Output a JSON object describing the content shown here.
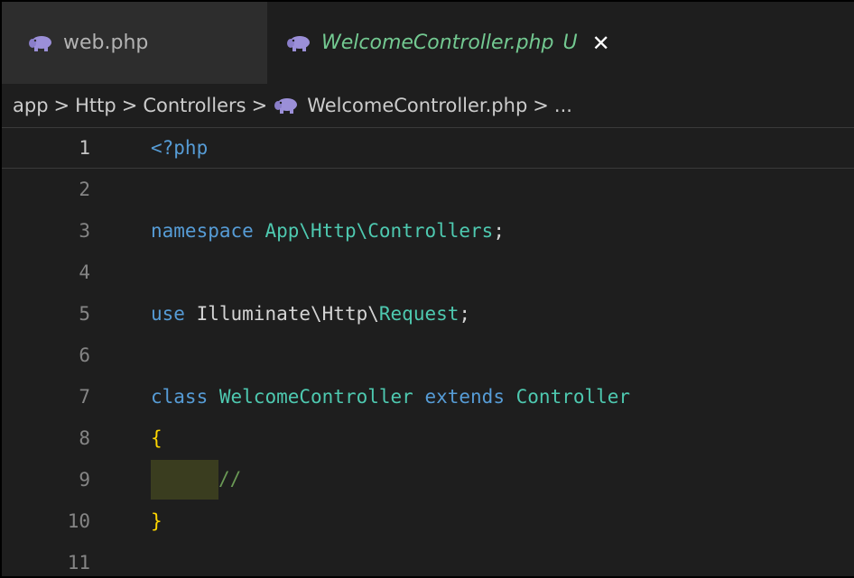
{
  "tabs": [
    {
      "label": "web.php",
      "active": false
    },
    {
      "label": "WelcomeController.php",
      "active": true,
      "status": "U",
      "close": "✕"
    }
  ],
  "breadcrumb": {
    "items": [
      "app",
      "Http",
      "Controllers",
      "WelcomeController.php",
      "..."
    ],
    "separator": ">"
  },
  "editor": {
    "lines": [
      {
        "number": "1"
      },
      {
        "number": "2"
      },
      {
        "number": "3"
      },
      {
        "number": "4"
      },
      {
        "number": "5"
      },
      {
        "number": "6"
      },
      {
        "number": "7"
      },
      {
        "number": "8"
      },
      {
        "number": "9"
      },
      {
        "number": "10"
      },
      {
        "number": "11"
      }
    ],
    "code": {
      "l1": "<?php",
      "l3_kw": "namespace",
      "l3_ns": "App\\Http\\Controllers",
      "l3_end": ";",
      "l5_kw": "use",
      "l5_ns": "Illuminate\\Http\\",
      "l5_cls": "Request",
      "l5_end": ";",
      "l7_kw": "class",
      "l7_cls": "WelcomeController",
      "l7_ext": "extends",
      "l7_parent": "Controller",
      "l8": "{",
      "l9": "//",
      "l10": "}"
    }
  },
  "colors": {
    "background": "#1e1e1e",
    "keyword": "#569cd6",
    "class": "#4ec9b0",
    "brace": "#ffd700",
    "comment": "#6a9955",
    "modified": "#73c991"
  }
}
